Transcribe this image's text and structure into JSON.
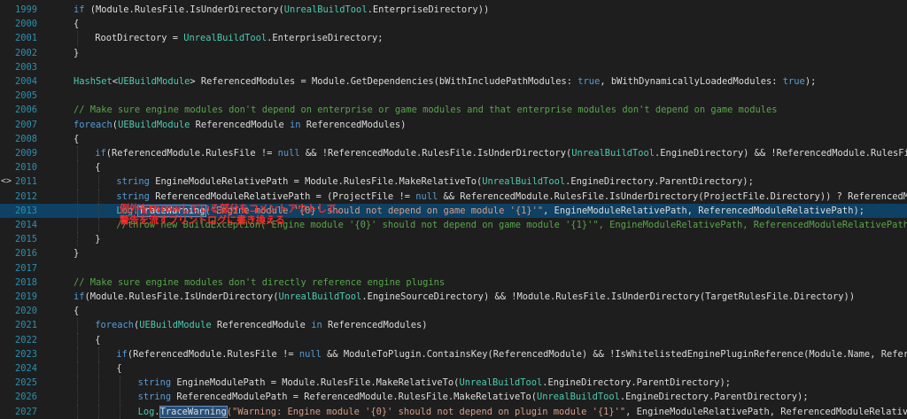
{
  "editor": {
    "lines": [
      {
        "n": "1999",
        "indent": 0,
        "parts": [
          [
            "k",
            "if"
          ],
          [
            "p",
            " (Module.RulesFile.IsUnderDirectory("
          ],
          [
            "t",
            "UnrealBuildTool"
          ],
          [
            "p",
            ".EnterpriseDirectory))"
          ]
        ]
      },
      {
        "n": "2000",
        "indent": 0,
        "parts": [
          [
            "p",
            "{"
          ]
        ]
      },
      {
        "n": "2001",
        "indent": 1,
        "parts": [
          [
            "p",
            "RootDirectory = "
          ],
          [
            "t",
            "UnrealBuildTool"
          ],
          [
            "p",
            ".EnterpriseDirectory;"
          ]
        ]
      },
      {
        "n": "2002",
        "indent": 0,
        "parts": [
          [
            "p",
            "}"
          ]
        ]
      },
      {
        "n": "2003",
        "indent": 0,
        "parts": []
      },
      {
        "n": "2004",
        "indent": 0,
        "parts": [
          [
            "t",
            "HashSet"
          ],
          [
            "p",
            "<"
          ],
          [
            "t",
            "UEBuildModule"
          ],
          [
            "p",
            "> ReferencedModules = Module.GetDependencies(bWithIncludePathModules: "
          ],
          [
            "k",
            "true"
          ],
          [
            "p",
            ", bWithDynamicallyLoadedModules: "
          ],
          [
            "k",
            "true"
          ],
          [
            "p",
            ");"
          ]
        ]
      },
      {
        "n": "2005",
        "indent": 0,
        "parts": []
      },
      {
        "n": "2006",
        "indent": 0,
        "parts": [
          [
            "c",
            "// Make sure engine modules don't depend on enterprise or game modules and that enterprise modules don't depend on game modules"
          ]
        ]
      },
      {
        "n": "2007",
        "indent": 0,
        "parts": [
          [
            "k",
            "foreach"
          ],
          [
            "p",
            "("
          ],
          [
            "t",
            "UEBuildModule"
          ],
          [
            "p",
            " ReferencedModule "
          ],
          [
            "k",
            "in"
          ],
          [
            "p",
            " ReferencedModules)"
          ]
        ]
      },
      {
        "n": "2008",
        "indent": 0,
        "parts": [
          [
            "p",
            "{"
          ]
        ]
      },
      {
        "n": "2009",
        "indent": 1,
        "parts": [
          [
            "k",
            "if"
          ],
          [
            "p",
            "(ReferencedModule.RulesFile != "
          ],
          [
            "k",
            "null"
          ],
          [
            "p",
            " && !ReferencedModule.RulesFile.IsUnderDirectory("
          ],
          [
            "t",
            "UnrealBuildTool"
          ],
          [
            "p",
            ".EngineDirectory) && !ReferencedModule.RulesFile.IsUn"
          ]
        ]
      },
      {
        "n": "2010",
        "indent": 1,
        "parts": [
          [
            "p",
            "{"
          ]
        ]
      },
      {
        "n": "2011",
        "indent": 2,
        "parts": [
          [
            "k",
            "string"
          ],
          [
            "p",
            " EngineModuleRelativePath = Module.RulesFile.MakeRelativeTo("
          ],
          [
            "t",
            "UnrealBuildTool"
          ],
          [
            "p",
            ".EngineDirectory.ParentDirectory);"
          ]
        ]
      },
      {
        "n": "2012",
        "indent": 2,
        "parts": [
          [
            "k",
            "string"
          ],
          [
            "p",
            " ReferencedModuleRelativePath = (ProjectFile != "
          ],
          [
            "k",
            "null"
          ],
          [
            "p",
            " && ReferencedModule.RulesFile.IsUnderDirectory(ProjectFile.Directory)) ? ReferencedModule."
          ]
        ]
      },
      {
        "n": "2013",
        "indent": 2,
        "hl": true,
        "parts": [
          [
            "t",
            "Log"
          ],
          [
            "p",
            "."
          ],
          [
            "sel",
            "TraceWarning"
          ],
          [
            "s",
            "(\"Engine module '{0}' should not depend on game module '{1}'\""
          ],
          [
            "p",
            ", EngineModuleRelativePath, ReferencedModuleRelativePath);"
          ]
        ]
      },
      {
        "n": "2014",
        "indent": 2,
        "parts": [
          [
            "c",
            "//throw new BuildException(\"Engine module '{0}' should not depend on game module '{1}'\", EngineModuleRelativePath, ReferencedModuleRelativePath);"
          ]
        ]
      },
      {
        "n": "2015",
        "indent": 1,
        "parts": [
          [
            "p",
            "}"
          ]
        ]
      },
      {
        "n": "2016",
        "indent": 0,
        "parts": [
          [
            "p",
            "}"
          ]
        ]
      },
      {
        "n": "2017",
        "indent": 0,
        "parts": []
      },
      {
        "n": "2018",
        "indent": 0,
        "parts": [
          [
            "c",
            "// Make sure engine modules don't directly reference engine plugins"
          ]
        ]
      },
      {
        "n": "2019",
        "indent": 0,
        "parts": [
          [
            "k",
            "if"
          ],
          [
            "p",
            "(Module.RulesFile.IsUnderDirectory("
          ],
          [
            "t",
            "UnrealBuildTool"
          ],
          [
            "p",
            ".EngineSourceDirectory) && !Module.RulesFile.IsUnderDirectory(TargetRulesFile.Directory))"
          ]
        ]
      },
      {
        "n": "2020",
        "indent": 0,
        "parts": [
          [
            "p",
            "{"
          ]
        ]
      },
      {
        "n": "2021",
        "indent": 1,
        "parts": [
          [
            "k",
            "foreach"
          ],
          [
            "p",
            "("
          ],
          [
            "t",
            "UEBuildModule"
          ],
          [
            "p",
            " ReferencedModule "
          ],
          [
            "k",
            "in"
          ],
          [
            "p",
            " ReferencedModules)"
          ]
        ]
      },
      {
        "n": "2022",
        "indent": 1,
        "parts": [
          [
            "p",
            "{"
          ]
        ]
      },
      {
        "n": "2023",
        "indent": 2,
        "parts": [
          [
            "k",
            "if"
          ],
          [
            "p",
            "(ReferencedModule.RulesFile != "
          ],
          [
            "k",
            "null"
          ],
          [
            "p",
            " && ModuleToPlugin.ContainsKey(ReferencedModule) && !IsWhitelistedEnginePluginReference(Module.Name, ReferencedM"
          ]
        ]
      },
      {
        "n": "2024",
        "indent": 2,
        "parts": [
          [
            "p",
            "{"
          ]
        ]
      },
      {
        "n": "2025",
        "indent": 3,
        "parts": [
          [
            "k",
            "string"
          ],
          [
            "p",
            " EngineModulePath = Module.RulesFile.MakeRelativeTo("
          ],
          [
            "t",
            "UnrealBuildTool"
          ],
          [
            "p",
            ".EngineDirectory.ParentDirectory);"
          ]
        ]
      },
      {
        "n": "2026",
        "indent": 3,
        "parts": [
          [
            "k",
            "string"
          ],
          [
            "p",
            " ReferencedModulePath = ReferencedModule.RulesFile.MakeRelativeTo("
          ],
          [
            "t",
            "UnrealBuildTool"
          ],
          [
            "p",
            ".EngineDirectory.ParentDirectory);"
          ]
        ]
      },
      {
        "n": "2027",
        "indent": 3,
        "parts": [
          [
            "t",
            "Log"
          ],
          [
            "p",
            "."
          ],
          [
            "sel",
            "TraceWarning"
          ],
          [
            "s",
            "(\"Warning: Engine module '{0}' should not depend on plugin module '{1}'\""
          ],
          [
            "p",
            ", EngineModuleRelativePath, ReferencedModuleRelativePath);"
          ]
        ]
      }
    ]
  },
  "annotation": {
    "text": "例外をthrowしている部分をコメントアウトして、\n警告を流すプリントログに書き換える",
    "color": "#ff2a2a"
  },
  "nav_icon": "code-nav-icon",
  "colors": {
    "background": "#1e1e1e",
    "line_number": "#2b91af",
    "keyword": "#569cd6",
    "type": "#4ec9b0",
    "string": "#d69d85",
    "comment": "#57a64a",
    "highlight": "#0e4164"
  }
}
